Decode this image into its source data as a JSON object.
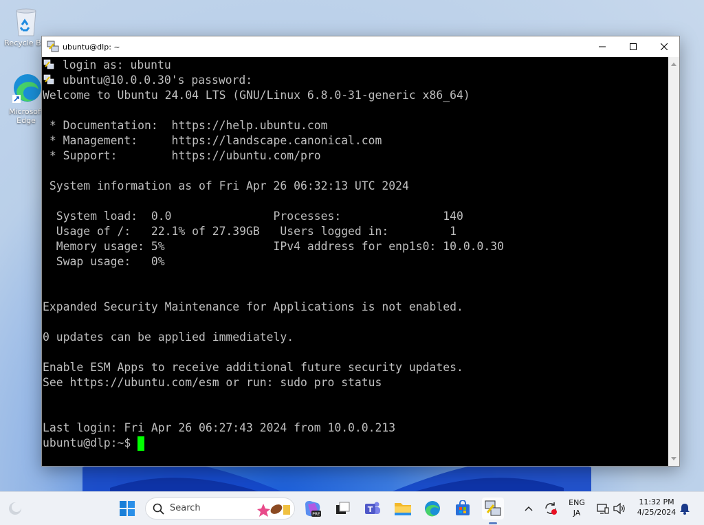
{
  "desktop": {
    "icons": [
      {
        "label": "Recycle Bin"
      },
      {
        "label": "Microsoft Edge"
      }
    ]
  },
  "window": {
    "title": "ubuntu@dlp: ~",
    "terminal_lines": [
      " login as: ubuntu",
      " ubuntu@10.0.0.30's password:",
      "Welcome to Ubuntu 24.04 LTS (GNU/Linux 6.8.0-31-generic x86_64)",
      "",
      " * Documentation:  https://help.ubuntu.com",
      " * Management:     https://landscape.canonical.com",
      " * Support:        https://ubuntu.com/pro",
      "",
      " System information as of Fri Apr 26 06:32:13 UTC 2024",
      "",
      "  System load:  0.0               Processes:               140",
      "  Usage of /:   22.1% of 27.39GB   Users logged in:         1",
      "  Memory usage: 5%                IPv4 address for enp1s0: 10.0.0.30",
      "  Swap usage:   0%",
      "",
      "",
      "Expanded Security Maintenance for Applications is not enabled.",
      "",
      "0 updates can be applied immediately.",
      "",
      "Enable ESM Apps to receive additional future security updates.",
      "See https://ubuntu.com/esm or run: sudo pro status",
      "",
      "",
      "Last login: Fri Apr 26 06:27:43 2024 from 10.0.0.213",
      "ubuntu@dlp:~$ "
    ]
  },
  "taskbar": {
    "search_placeholder": "Search",
    "language_top": "ENG",
    "language_bottom": "JA",
    "time": "11:32 PM",
    "date": "4/25/2024"
  },
  "colors": {
    "terminal_bg": "#000000",
    "terminal_fg": "#bfbfbf",
    "cursor": "#00ff00",
    "taskbar_bg": "#eef1f6"
  }
}
